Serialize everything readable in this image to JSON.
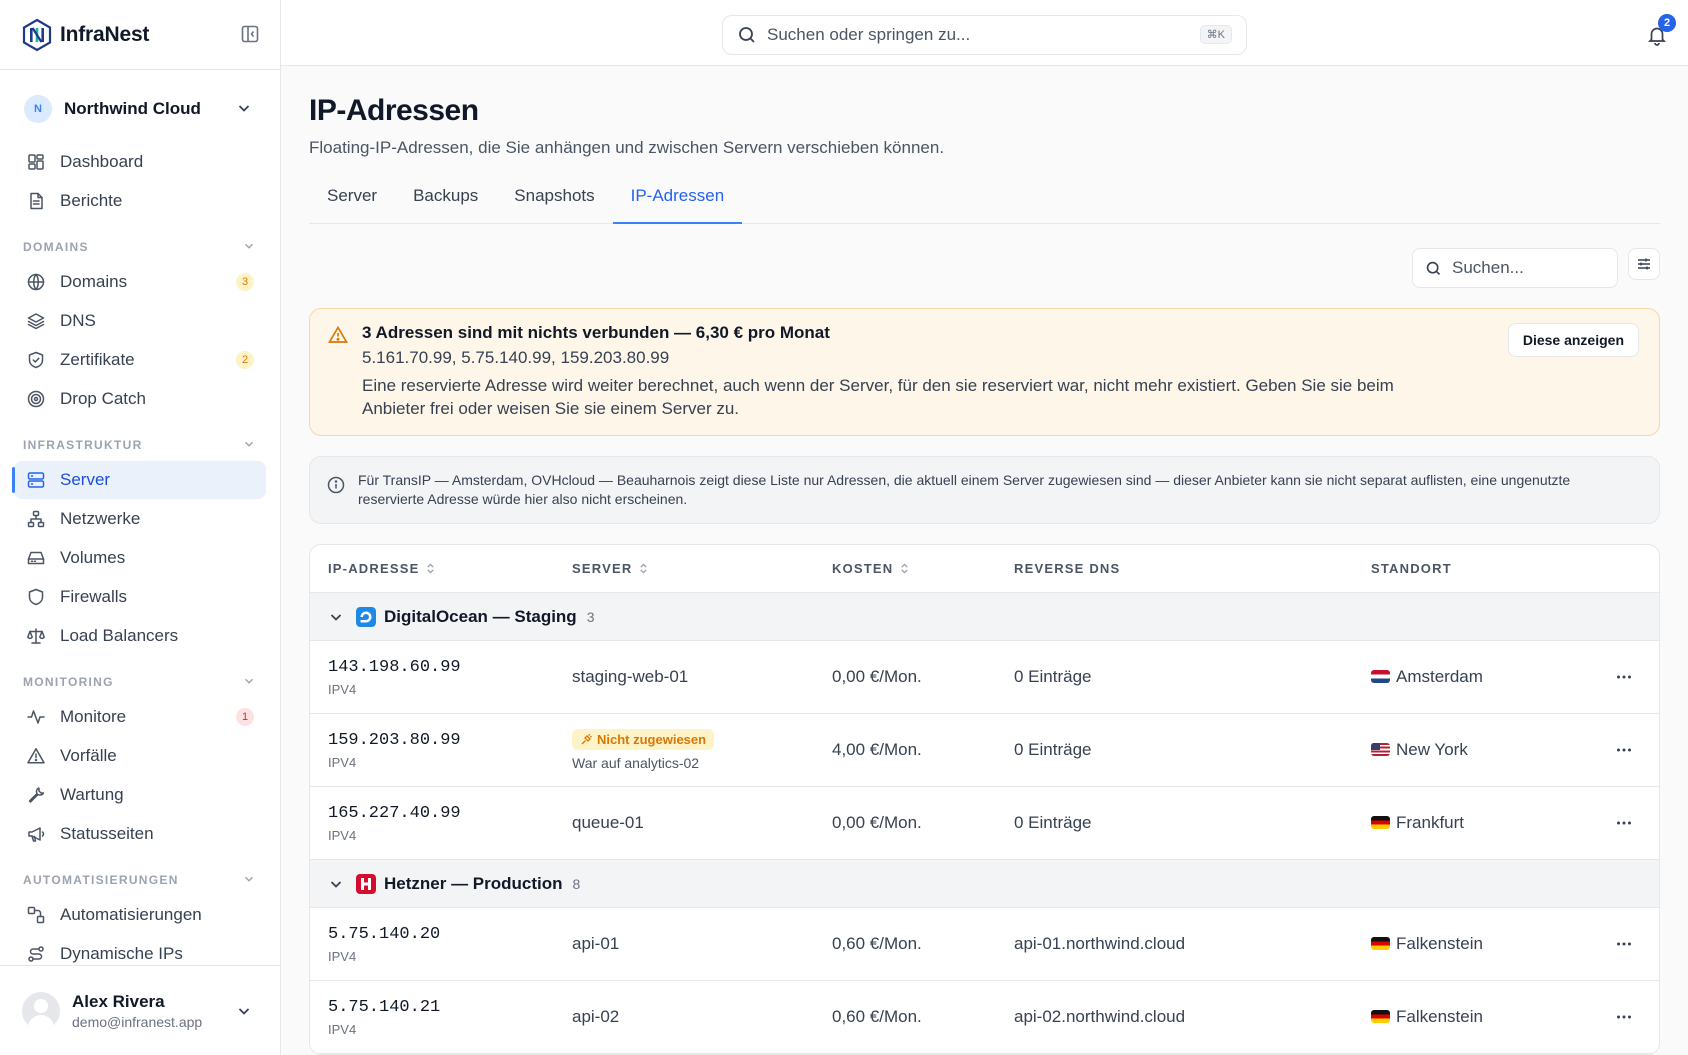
{
  "app": {
    "name": "InfraNest"
  },
  "org": {
    "initial": "N",
    "name": "Northwind Cloud"
  },
  "nav": {
    "top": [
      {
        "label": "Dashboard",
        "icon": "dashboard-icon"
      },
      {
        "label": "Berichte",
        "icon": "report-icon"
      }
    ],
    "sections": [
      {
        "title": "DOMAINS",
        "items": [
          {
            "label": "Domains",
            "icon": "globe-icon",
            "badge": "3",
            "badge_type": "warn"
          },
          {
            "label": "DNS",
            "icon": "layers-icon"
          },
          {
            "label": "Zertifikate",
            "icon": "shield-check-icon",
            "badge": "2",
            "badge_type": "warn"
          },
          {
            "label": "Drop Catch",
            "icon": "target-icon"
          }
        ]
      },
      {
        "title": "INFRASTRUKTUR",
        "items": [
          {
            "label": "Server",
            "icon": "server-icon",
            "active": true
          },
          {
            "label": "Netzwerke",
            "icon": "network-icon"
          },
          {
            "label": "Volumes",
            "icon": "hard-drive-icon"
          },
          {
            "label": "Firewalls",
            "icon": "shield-icon"
          },
          {
            "label": "Load Balancers",
            "icon": "scale-icon"
          }
        ]
      },
      {
        "title": "MONITORING",
        "items": [
          {
            "label": "Monitore",
            "icon": "activity-icon",
            "badge": "1",
            "badge_type": "err"
          },
          {
            "label": "Vorfälle",
            "icon": "alert-triangle-icon"
          },
          {
            "label": "Wartung",
            "icon": "wrench-icon"
          },
          {
            "label": "Statusseiten",
            "icon": "megaphone-icon"
          }
        ]
      },
      {
        "title": "AUTOMATISIERUNGEN",
        "items": [
          {
            "label": "Automatisierungen",
            "icon": "workflow-icon"
          },
          {
            "label": "Dynamische IPs",
            "icon": "route-icon"
          }
        ]
      }
    ]
  },
  "user": {
    "name": "Alex Rivera",
    "email": "demo@infranest.app"
  },
  "topbar": {
    "search_placeholder": "Suchen oder springen zu...",
    "shortcut": "⌘K",
    "notifications": "2"
  },
  "page": {
    "title": "IP-Adressen",
    "subtitle": "Floating-IP-Adressen, die Sie anhängen und zwischen Servern verschieben können."
  },
  "tabs": [
    "Server",
    "Backups",
    "Snapshots",
    "IP-Adressen"
  ],
  "active_tab": 3,
  "search": {
    "placeholder": "Suchen..."
  },
  "warning": {
    "title": "3 Adressen sind mit nichts verbunden — 6,30 € pro Monat",
    "ips": "5.161.70.99, 5.75.140.99, 159.203.80.99",
    "text": "Eine reservierte Adresse wird weiter berechnet, auch wenn der Server, für den sie reserviert war, nicht mehr existiert. Geben Sie sie beim Anbieter frei oder weisen Sie sie einem Server zu.",
    "button": "Diese anzeigen"
  },
  "info": {
    "text": "Für TransIP — Amsterdam, OVHcloud — Beauharnois zeigt diese Liste nur Adressen, die aktuell einem Server zugewiesen sind — dieser Anbieter kann sie nicht separat auflisten, eine ungenutzte reservierte Adresse würde hier also nicht erscheinen."
  },
  "table": {
    "columns": [
      "IP-ADRESSE",
      "SERVER",
      "KOSTEN",
      "REVERSE DNS",
      "STANDORT"
    ],
    "groups": [
      {
        "name": "DigitalOcean — Staging",
        "count": "3",
        "logo": "digitalocean-logo-icon",
        "color": "#1e88e5",
        "rows": [
          {
            "ip": "143.198.60.99",
            "type": "IPV4",
            "server": "staging-web-01",
            "cost": "0,00 €/Mon.",
            "rdns": "0 Einträge",
            "flag": "nl",
            "location": "Amsterdam"
          },
          {
            "ip": "159.203.80.99",
            "type": "IPV4",
            "unassigned": "Nicht zugewiesen",
            "server_sub": "War auf analytics-02",
            "cost": "4,00 €/Mon.",
            "rdns": "0 Einträge",
            "flag": "us",
            "location": "New York"
          },
          {
            "ip": "165.227.40.99",
            "type": "IPV4",
            "server": "queue-01",
            "cost": "0,00 €/Mon.",
            "rdns": "0 Einträge",
            "flag": "de",
            "location": "Frankfurt"
          }
        ]
      },
      {
        "name": "Hetzner — Production",
        "count": "8",
        "logo": "hetzner-logo-icon",
        "color": "#d50c2d",
        "rows": [
          {
            "ip": "5.75.140.20",
            "type": "IPV4",
            "server": "api-01",
            "cost": "0,60 €/Mon.",
            "rdns": "api-01.northwind.cloud",
            "flag": "de",
            "location": "Falkenstein"
          },
          {
            "ip": "5.75.140.21",
            "type": "IPV4",
            "server": "api-02",
            "cost": "0,60 €/Mon.",
            "rdns": "api-02.northwind.cloud",
            "flag": "de",
            "location": "Falkenstein"
          }
        ]
      }
    ]
  },
  "colors": {
    "accent": "#2563eb",
    "warning": "#d97706",
    "danger": "#dc2626"
  }
}
